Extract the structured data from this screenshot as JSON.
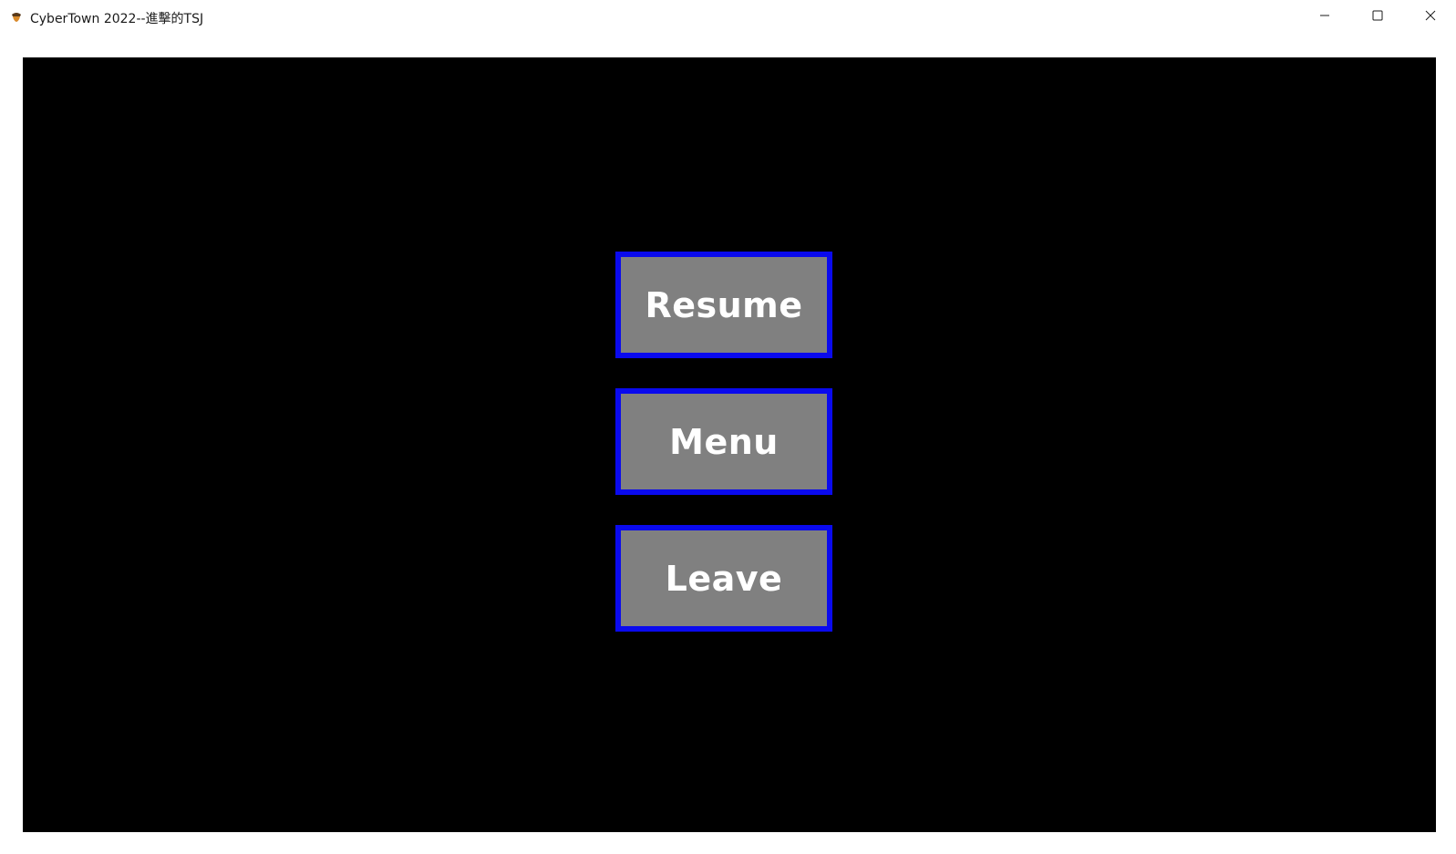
{
  "window": {
    "title": "CyberTown 2022--進擊的TSJ",
    "icon": "acorn-app-icon",
    "controls": {
      "minimize_icon": "minimize-icon",
      "maximize_icon": "maximize-icon",
      "close_icon": "close-icon"
    }
  },
  "pause_menu": {
    "resume_label": "Resume",
    "menu_label": "Menu",
    "leave_label": "Leave"
  },
  "colors": {
    "canvas_background": "#000000",
    "button_fill": "#808080",
    "button_border": "#0a0aee",
    "button_text": "#ffffff"
  }
}
